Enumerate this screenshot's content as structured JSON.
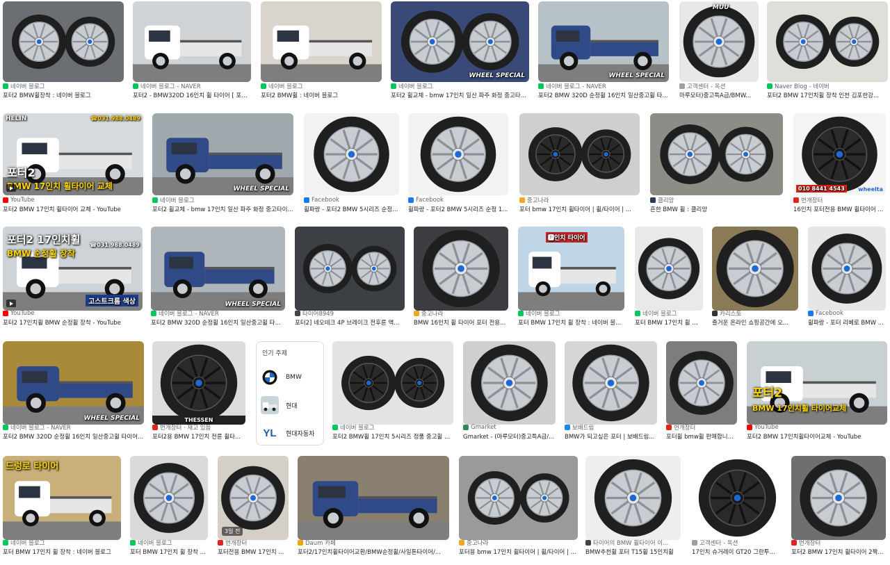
{
  "tiles": [
    {
      "src": "네이버 블로그",
      "title": "포터2 BMW휠장착 : 네이버 블로그",
      "fav": "#03c75a",
      "bg": "#6b6f73",
      "kind": "wheel"
    },
    {
      "src": "네이버 블로그 - NAVER",
      "title": "포터2 - BMW320D 16인치 휠 타이어 [ 포터...",
      "fav": "#03c75a",
      "bg": "#cfd3d6",
      "kind": "truck-white"
    },
    {
      "src": "네이버 블로그",
      "title": "포터2 BMW휠 : 네이버 블로그",
      "fav": "#03c75a",
      "bg": "#d9d4cc",
      "kind": "truck-white"
    },
    {
      "src": "네이버 블로그",
      "title": "포터2 휠교체 - bmw 17인치 일산 파주 화정 중고타...",
      "fav": "#03c75a",
      "bg": "#3a4a78",
      "kind": "wheel"
    },
    {
      "src": "네이버 블로그 - NAVER",
      "title": "포터2 BMW 320D 순정휠 16인치 일산중고휠 타...",
      "fav": "#03c75a",
      "bg": "#b6c1c8",
      "kind": "truck-blue"
    },
    {
      "src": "고객센터 - 옥션",
      "title": "마루모터)중고특A급/BMW...",
      "fav": "#9aa0a6",
      "bg": "#e8e8e8",
      "kind": "wheel"
    },
    {
      "src": "Naver Blog - 네이버",
      "title": "포터2 BMW 17인치휠 장착 인천 김포한강...",
      "fav": "#03c75a",
      "bg": "#e0ded8",
      "kind": "wheel"
    },
    {
      "src": "YouTube",
      "title": "포터2 BMW 17인치 휠타이어 교체 - YouTube",
      "fav": "#ff0000",
      "bg": "#d8dbdd",
      "kind": "truck-white"
    },
    {
      "src": "네이버 블로그",
      "title": "포터2 휠교체 - bmw 17인치 일산 파주 화정 중고타이...",
      "fav": "#03c75a",
      "bg": "#9fa8ad",
      "kind": "truck-blue"
    },
    {
      "src": "Facebook",
      "title": "휠파랑 - 포터2 BMW 5시리즈 순정...",
      "fav": "#1877f2",
      "bg": "#f2f2f2",
      "kind": "wheel"
    },
    {
      "src": "Facebook",
      "title": "휠파랑 - 포터2 BMW 5시리즈 순정 1...",
      "fav": "#1877f2",
      "bg": "#f2f2f2",
      "kind": "wheel"
    },
    {
      "src": "중고나라",
      "title": "포터 bmw 17인치 휠타이어 | 휠/타이어 | ...",
      "fav": "#f5a623",
      "bg": "#cfcfcf",
      "kind": "wheel-black"
    },
    {
      "src": "클리앙",
      "title": "흔한 BMW 휠 : 클리앙",
      "fav": "#2b3a55",
      "bg": "#8e8c87",
      "kind": "wheel"
    },
    {
      "src": "번개장터",
      "title": "16인치 포터전용 BMW 휠타이어 ...",
      "fav": "#e1251b",
      "bg": "#f4f4f4",
      "kind": "wheel-black"
    },
    {
      "src": "YouTube",
      "title": "포터2 17인치휠 BMW 순정휠 장착 - YouTube",
      "fav": "#ff0000",
      "bg": "#cdd3d6",
      "kind": "truck-white"
    },
    {
      "src": "네이버 블로그 - NAVER",
      "title": "포터2 BMW 320D 순정휠 16인치 일산중고휠 타이...",
      "fav": "#03c75a",
      "bg": "#aeb6bb",
      "kind": "truck-blue"
    },
    {
      "src": "타이어8949",
      "title": "포터2] 네오테크 4P 브레이크 전후륜 액...",
      "fav": "#444444",
      "bg": "#3c3f44",
      "kind": "wheel"
    },
    {
      "src": "중고나라",
      "title": "BMW 16인치 휠 타이어 포터 전용...",
      "fav": "#f5a623",
      "bg": "#3b3d40",
      "kind": "wheel"
    },
    {
      "src": "네이버 블로그",
      "title": "포터 BMW 17인치 휠 장착 : 네이버 블...",
      "fav": "#03c75a",
      "bg": "#bfd6e8",
      "kind": "truck-white"
    },
    {
      "src": "네이버 블로그",
      "title": "포터 BMW 17인치 휠 장...",
      "fav": "#03c75a",
      "bg": "#e9e9e9",
      "kind": "wheel"
    },
    {
      "src": "카리스토",
      "title": "즐거운 온라인 쇼핑공간에 오...",
      "fav": "#333333",
      "bg": "#8a7a55",
      "kind": "wheel"
    },
    {
      "src": "Facebook",
      "title": "휠파랑 - 포터 리베로 BMW ...",
      "fav": "#1877f2",
      "bg": "#e6e6e6",
      "kind": "wheel"
    },
    {
      "src": "네이버 블로그 - NAVER",
      "title": "포터2 BMW 320D 순정휠 16인치 일산중고휠 타이어...",
      "fav": "#03c75a",
      "bg": "#a98a3a",
      "kind": "truck-blue"
    },
    {
      "src": "번개장터 · 재고 있음",
      "title": "포터2용 BMW 17인치 전륜 휠타...",
      "fav": "#e1251b",
      "bg": "#dcdcdc",
      "kind": "wheel-black"
    },
    {
      "src": "네이버 블로그",
      "title": "포터2 BMW휠 17인치 5시리즈 정품 중고휠 ...",
      "fav": "#03c75a",
      "bg": "#e3e3e3",
      "kind": "wheel-black"
    },
    {
      "src": "Gmarket",
      "title": "Gmarket - (마루모터)중고특A급/...",
      "fav": "#2e8b57",
      "bg": "#cfcfcf",
      "kind": "wheel"
    },
    {
      "src": "보배드림",
      "title": "BMW가 되고싶은 포터 | 보배드림...",
      "fav": "#1e88e5",
      "bg": "#d6d6d6",
      "kind": "wheel"
    },
    {
      "src": "번개장터",
      "title": "포터휠 bmw휠 판매합니...",
      "fav": "#e1251b",
      "bg": "#7d7d7d",
      "kind": "wheel"
    },
    {
      "src": "YouTube",
      "title": "포터2 BMW 17인치휠타이어교체 - YouTube",
      "fav": "#ff0000",
      "bg": "#c9d0d4",
      "kind": "truck-white"
    },
    {
      "src": "네이버 블로그",
      "title": "포터 BMW 17인치 휠 장착 : 네이버 블로그",
      "fav": "#03c75a",
      "bg": "#c9b07a",
      "kind": "truck-white"
    },
    {
      "src": "네이버 블로그",
      "title": "포터 BMW 17인치 휠 장착 ...",
      "fav": "#03c75a",
      "bg": "#d9d9d9",
      "kind": "wheel"
    },
    {
      "src": "번개장터",
      "title": "포터전용 BMW 17인치 ...",
      "fav": "#e1251b",
      "bg": "#d4cfc7",
      "kind": "wheel"
    },
    {
      "src": "Daum 카페",
      "title": "포터2/17인치휠타이어교환/BMW순정휠/사일톤타이어/...",
      "fav": "#f0a500",
      "bg": "#8a8070",
      "kind": "truck-blue"
    },
    {
      "src": "중고나라",
      "title": "포터용 bmw 17인치 휠타이어 | 휠/타이어 | ...",
      "fav": "#f5a623",
      "bg": "#9a9a9a",
      "kind": "wheel"
    },
    {
      "src": "타이어의 BMW 휠타이어 이...",
      "title": "BMW추천휠 포터 T15휠 15인치휠",
      "fav": "#444444",
      "bg": "#eeeeee",
      "kind": "wheel"
    },
    {
      "src": "고객센터 - 옥션",
      "title": "17인치 슈거레이 GT20 그란투...",
      "fav": "#9aa0a6",
      "bg": "#ffffff",
      "kind": "wheel-black"
    },
    {
      "src": "번개장터",
      "title": "포터2 BMW 17인치 휠타이어 2짝...",
      "fav": "#e1251b",
      "bg": "#6f6f6f",
      "kind": "wheel"
    }
  ],
  "overlays": {
    "t7_title": "포터2",
    "t7_sub": "BMW 17인치 휠타이어 교체",
    "t7_top": "HELIN",
    "t7_phone": "☎031.988.0489",
    "t14_title": "포터2 17인치휠",
    "t14_sub": "BMW 순정휠 장착",
    "t14_badge": "고스트크롬 색상",
    "t14_phone": "☎031.988.0489",
    "t28_title": "포터2",
    "t28_sub": "BMW 17인치휠 타이어교체",
    "t29_sign": "드렁로 타이어",
    "t31_age": "3일 전",
    "t18_sign": "🅿인치 타이어",
    "wheel_special": "WHEEL SPECIAL",
    "t13_phone": "010 8441 4543",
    "t13_brand": "wheelta",
    "t23_brand": "THESSEN",
    "t5_brand": "MUU"
  },
  "trending": {
    "header": "인기 주제",
    "items": [
      {
        "label": "BMW"
      },
      {
        "label": "현대"
      },
      {
        "label": "현대자동차",
        "logo": "YL"
      }
    ]
  }
}
